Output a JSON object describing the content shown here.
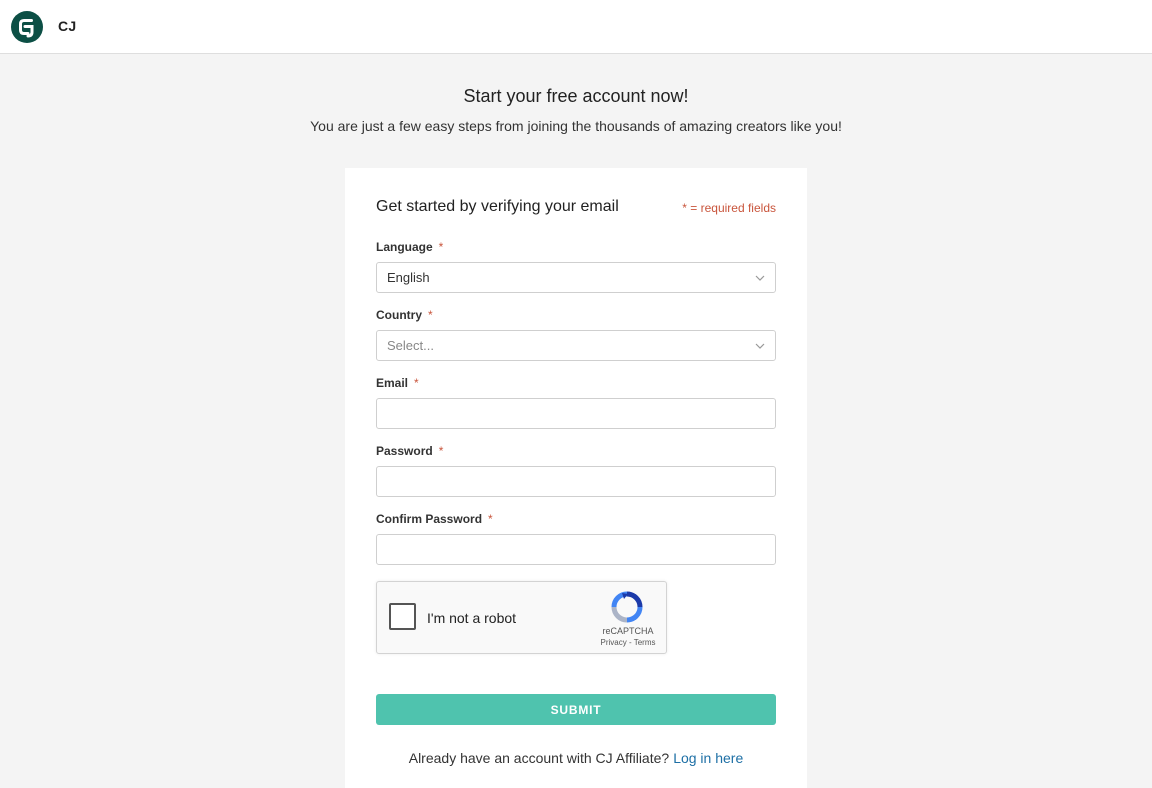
{
  "header": {
    "brand": "CJ",
    "logo_icon": "cj-logo-icon",
    "logo_color": "#0c4f45"
  },
  "hero": {
    "title": "Start your free account now!",
    "subtitle": "You are just a few easy steps from joining the thousands of amazing creators like you!"
  },
  "form": {
    "title": "Get started by verifying your email",
    "required_note": "* = required fields",
    "required_marker": "*",
    "fields": {
      "language": {
        "label": "Language",
        "value": "English"
      },
      "country": {
        "label": "Country",
        "placeholder": "Select..."
      },
      "email": {
        "label": "Email",
        "value": ""
      },
      "password": {
        "label": "Password",
        "value": ""
      },
      "confirm_password": {
        "label": "Confirm Password",
        "value": ""
      }
    },
    "recaptcha": {
      "label": "I'm not a robot",
      "brand": "reCAPTCHA",
      "links": "Privacy - Terms"
    },
    "submit_label": "SUBMIT",
    "login_prompt": "Already have an account with CJ Affiliate?",
    "login_link": "Log in here"
  },
  "colors": {
    "accent": "#4fc3ae",
    "required": "#c9553c",
    "link": "#1d6fa5",
    "background": "#f4f4f4"
  }
}
